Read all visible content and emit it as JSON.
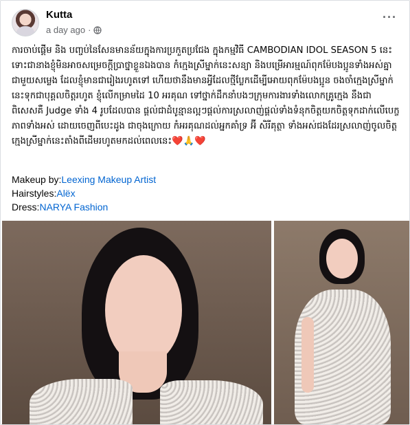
{
  "post": {
    "author": "Kutta",
    "time": "a day ago",
    "more_label": "···",
    "caption": "ការចាប់ផ្តើម និង បញ្ចប់នៃសែនមានន័យក្នុងការប្រកួតប្រជែង ក្នុងកម្មវិធី CAMBODIAN IDOL SEASON 5 នេះទោះជានាងខ្ញុំមិនអាចសម្រេចក្តីប្រាថ្នាខ្លួនឯងបាន កំក្មេងស្រីម្នាក់នេះសន្យា និងបម្រើអារម្មណ៍ពុកម៉ែបងប្អូនទាំងអស់គ្នាជាមួយសម្លេង ដែលខ្ញុំមានជារៀងរហូតទៅ ហើយថានឹងមានអ្វីដែលថ្មីប្លែកដើម្បីអោយពុកម៉ែបងប្អូន ចងចាំក្មេងស្រីម្នាក់នេះទុកជាបុគ្គលចិត្តរហូត ខ្ញុំលើកម្រាមដៃ 10 អរគុណ ទៅថ្នាក់ដឹកនាំបងៗក្រុមការងារទាំងលោកគ្រូក្មេង នឹងជាពិសេសគឺ Judge ទាំង 4 រូបដែលបាន ផ្តល់ជាដំបូន្មានល្អៗផ្តល់ការស្រលាញ់ផ្តល់ទាំងទំនុកចិត្តយកចិត្តទុកដាក់លើបេក្ខភាពទាំងអស់ ដោយចេញពីបេះដូង ជាចុងក្រោយ កំអរគុណដល់អ្នកគាំទ្រ អ៊ី សិរីគុត្ថា ទាំងអស់ជងដែរស្រលាញ់ចូលចិត្ត ក្មេងស្រីម្នាក់នេះតាំងពីដើមរហូតមកដល់ពេលនេះ❤️🙏❤️",
    "credits": {
      "makeup_label": "Makeup by:",
      "makeup_link": "Leexing Makeup Artist",
      "hair_label": "Hairstyles:",
      "hair_link": "Alëx",
      "dress_label": "Dress:",
      "dress_link": "NARYA Fashion"
    }
  },
  "icons": {
    "globe": "globe-icon",
    "avatar": "profile-avatar"
  },
  "colors": {
    "link": "#0064d1",
    "meta": "#65676b",
    "border": "#dadde1"
  }
}
